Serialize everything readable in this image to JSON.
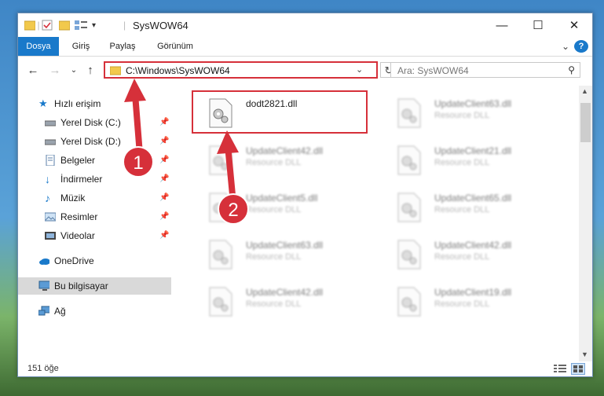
{
  "window": {
    "title": "SysWOW64",
    "controls": {
      "minimize": "—",
      "maximize": "☐",
      "close": "✕"
    }
  },
  "ribbon": {
    "tabs": [
      {
        "label": "Dosya"
      },
      {
        "label": "Giriş"
      },
      {
        "label": "Paylaş"
      },
      {
        "label": "Görünüm"
      }
    ]
  },
  "nav": {
    "address": "C:\\Windows\\SysWOW64",
    "search_placeholder": "Ara: SysWOW64"
  },
  "sidebar": {
    "items": [
      {
        "label": "Hızlı erişim",
        "icon": "star-icon"
      },
      {
        "label": "Yerel Disk (C:)",
        "icon": "drive-icon"
      },
      {
        "label": "Yerel Disk (D:)",
        "icon": "drive-icon"
      },
      {
        "label": "Belgeler",
        "icon": "documents-icon"
      },
      {
        "label": "İndirmeler",
        "icon": "download-icon"
      },
      {
        "label": "Müzik",
        "icon": "music-icon"
      },
      {
        "label": "Resimler",
        "icon": "pictures-icon"
      },
      {
        "label": "Videolar",
        "icon": "videos-icon"
      },
      {
        "label": "OneDrive",
        "icon": "cloud-icon"
      },
      {
        "label": "Bu bilgisayar",
        "icon": "computer-icon"
      },
      {
        "label": "Ağ",
        "icon": "network-icon"
      }
    ]
  },
  "files": [
    {
      "name": "dodt2821.dll",
      "desc": ""
    },
    {
      "name": "UpdateClient63.dll",
      "desc": "Resource DLL"
    },
    {
      "name": "UpdateClient42.dll",
      "desc": "Resource DLL"
    },
    {
      "name": "UpdateClient21.dll",
      "desc": "Resource DLL"
    },
    {
      "name": "UpdateClient5.dll",
      "desc": "Resource DLL"
    },
    {
      "name": "UpdateClient65.dll",
      "desc": "Resource DLL"
    },
    {
      "name": "UpdateClient63.dll",
      "desc": "Resource DLL"
    },
    {
      "name": "UpdateClient42.dll",
      "desc": "Resource DLL"
    },
    {
      "name": "UpdateClient42.dll",
      "desc": "Resource DLL"
    },
    {
      "name": "UpdateClient19.dll",
      "desc": "Resource DLL"
    }
  ],
  "status": {
    "count": "151 öğe"
  },
  "annotations": [
    {
      "label": "1"
    },
    {
      "label": "2"
    }
  ],
  "colors": {
    "accent": "#1979ca",
    "highlight": "#d6303a"
  }
}
